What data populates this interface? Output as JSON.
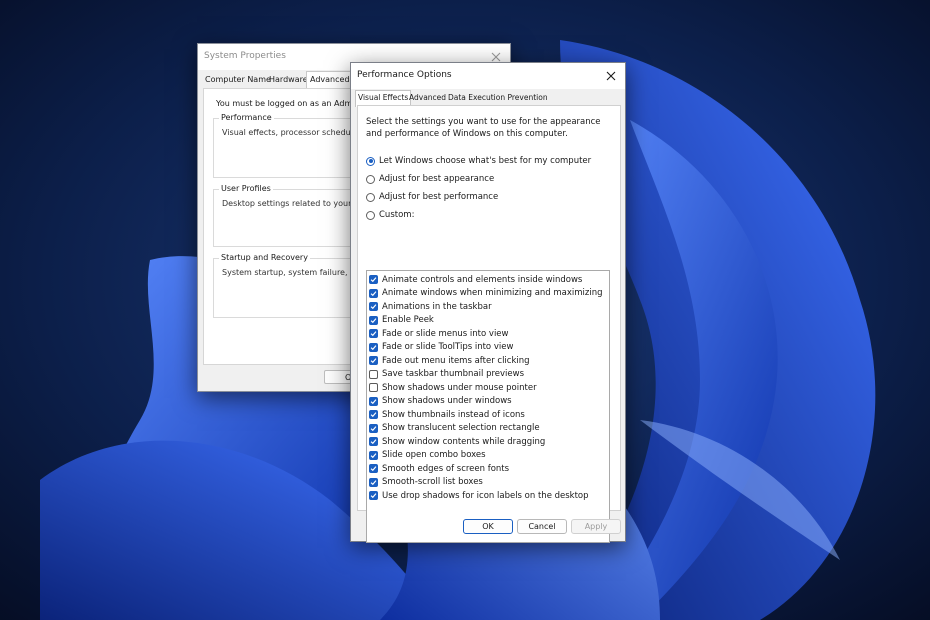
{
  "system_properties": {
    "title": "System Properties",
    "tabs": [
      "Computer Name",
      "Hardware",
      "Advanced"
    ],
    "admin_notice": "You must be logged on as an Administra",
    "groups": [
      {
        "label": "Performance",
        "description": "Visual effects, processor scheduling, m"
      },
      {
        "label": "User Profiles",
        "description": "Desktop settings related to your sign-i"
      },
      {
        "label": "Startup and Recovery",
        "description": "System startup, system failure, and deb"
      }
    ],
    "ok_label": "O"
  },
  "performance_options": {
    "title": "Performance Options",
    "tabs": [
      "Visual Effects",
      "Advanced",
      "Data Execution Prevention"
    ],
    "description": "Select the settings you want to use for the appearance and performance of Windows on this computer.",
    "radios": [
      {
        "label": "Let Windows choose what's best for my computer",
        "selected": true
      },
      {
        "label": "Adjust for best appearance",
        "selected": false
      },
      {
        "label": "Adjust for best performance",
        "selected": false
      },
      {
        "label": "Custom:",
        "selected": false
      }
    ],
    "effects": [
      {
        "label": "Animate controls and elements inside windows",
        "checked": true
      },
      {
        "label": "Animate windows when minimizing and maximizing",
        "checked": true
      },
      {
        "label": "Animations in the taskbar",
        "checked": true
      },
      {
        "label": "Enable Peek",
        "checked": true
      },
      {
        "label": "Fade or slide menus into view",
        "checked": true
      },
      {
        "label": "Fade or slide ToolTips into view",
        "checked": true
      },
      {
        "label": "Fade out menu items after clicking",
        "checked": true
      },
      {
        "label": "Save taskbar thumbnail previews",
        "checked": false
      },
      {
        "label": "Show shadows under mouse pointer",
        "checked": false
      },
      {
        "label": "Show shadows under windows",
        "checked": true
      },
      {
        "label": "Show thumbnails instead of icons",
        "checked": true
      },
      {
        "label": "Show translucent selection rectangle",
        "checked": true
      },
      {
        "label": "Show window contents while dragging",
        "checked": true
      },
      {
        "label": "Slide open combo boxes",
        "checked": true
      },
      {
        "label": "Smooth edges of screen fonts",
        "checked": true
      },
      {
        "label": "Smooth-scroll list boxes",
        "checked": true
      },
      {
        "label": "Use drop shadows for icon labels on the desktop",
        "checked": true
      }
    ],
    "buttons": {
      "ok": "OK",
      "cancel": "Cancel",
      "apply": "Apply"
    }
  },
  "colors": {
    "accent": "#1a5fc2",
    "wallpaper_dark": "#0a1a3a",
    "wallpaper_bloom": "#1f4fe0"
  }
}
